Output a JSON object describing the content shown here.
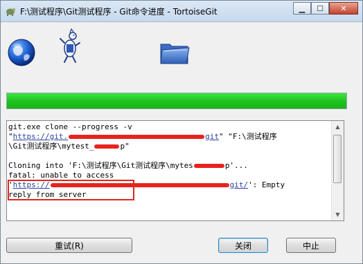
{
  "window": {
    "title": "F:\\测试程序\\Git测试程序 - Git命令进度 - TortoiseGit"
  },
  "icons": {
    "app": "tortoisegit-app-icon",
    "globe": "globe-network-icon",
    "tortoise": "tortoise-mascot-icon",
    "folder": "blue-folder-icon"
  },
  "progress": {
    "value": 1.0
  },
  "log": {
    "line1": "git.exe clone --progress -v",
    "line2_prefix": "\"",
    "line2_link": "https://git.",
    "line2_link_end": "git",
    "line2_suffix": "\" \"F:\\测试程序",
    "line3_prefix": "\\Git测试程序\\mytest_",
    "line3_suffix": "p\"",
    "line5_prefix": "Cloning into 'F:\\测试程序\\Git测试程序\\mytes",
    "line5_suffix": "p'...",
    "line6": "fatal: unable to access",
    "line7_prefix": "'",
    "line7_link": "https://",
    "line7_link_end": "git/",
    "line7_suffix": "': Empty",
    "line8": "reply from server"
  },
  "buttons": {
    "retry": "重试(R)",
    "close": "关闭",
    "abort": "中止"
  },
  "colors": {
    "progress_green": "#1fbf1f",
    "redaction_red": "#e8231f",
    "highlight_red": "#e0261f",
    "link_blue": "#2a3f9e"
  }
}
